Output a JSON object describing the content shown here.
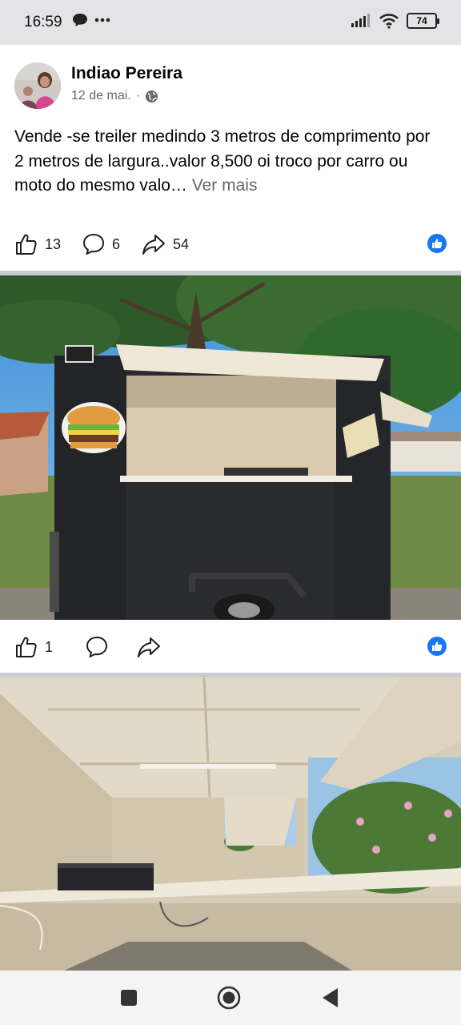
{
  "status_bar": {
    "time": "16:59",
    "battery": "74"
  },
  "post": {
    "author": "Indiao Pereira",
    "date": "12 de mai.",
    "separator": "·",
    "text": "Vende -se treiler medindo 3 metros de comprimento por 2 metros de largura..valor 8,500 oi troco por carro ou moto do mesmo valo…",
    "see_more": "Ver mais",
    "likes": "13",
    "comments": "6",
    "shares": "54"
  },
  "photo1": {
    "likes": "1"
  },
  "colors": {
    "facebook_blue": "#1877f2",
    "meta_gray": "#65676b",
    "divider": "#c9ccd1"
  },
  "icons": [
    "message-icon",
    "more-dots-icon",
    "signal-icon",
    "wifi-icon",
    "battery-icon",
    "globe-icon",
    "like-icon",
    "comment-icon",
    "share-icon",
    "like-badge-icon",
    "recent-apps-icon",
    "home-icon",
    "back-icon"
  ]
}
